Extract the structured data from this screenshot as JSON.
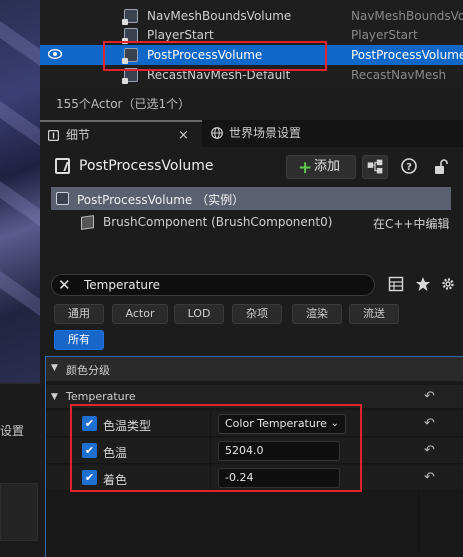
{
  "outliner": {
    "rows": [
      {
        "name": "NavMeshBoundsVolume",
        "type": "NavMeshBoundsVolume"
      },
      {
        "name": "PlayerStart",
        "type": "PlayerStart"
      },
      {
        "name": "PostProcessVolume",
        "type": "PostProcessVolume"
      },
      {
        "name": "RecastNavMesh-Default",
        "type": "RecastNavMesh"
      }
    ],
    "status": "155个Actor（已选1个）"
  },
  "left_panel": {
    "label": "设置"
  },
  "tabs": [
    {
      "label": "细节",
      "close": "×"
    },
    {
      "label": "世界场景设置"
    }
  ],
  "details": {
    "actor_name": "PostProcessVolume",
    "add_button": "添加",
    "add_icon": "+",
    "components": [
      {
        "label": "PostProcessVolume （实例）"
      },
      {
        "label": "BrushComponent (BrushComponent0)",
        "action": "在C++中编辑"
      }
    ]
  },
  "search": {
    "clear": "✕",
    "value": "Temperature",
    "icons": [
      "table-icon",
      "star-icon",
      "gear-icon"
    ]
  },
  "filters": [
    "通用",
    "Actor",
    "LOD",
    "杂项",
    "渲染",
    "流送",
    "所有"
  ],
  "active_filter": "所有",
  "properties": {
    "category": "颜色分级",
    "subcategory": "Temperature",
    "rows": [
      {
        "label": "色温类型",
        "value": "Color Temperature",
        "kind": "select",
        "checked": "✔"
      },
      {
        "label": "色温",
        "value": "5204.0",
        "kind": "number",
        "checked": "✔"
      },
      {
        "label": "着色",
        "value": "-0.24",
        "kind": "number",
        "checked": "✔"
      }
    ],
    "reset_icon": "↶",
    "chevron": "⌄",
    "expanded_arrow": "▼"
  },
  "colors": {
    "selection": "#0f68c8",
    "highlight_box": "#e0242b",
    "accent": "#1f6fd1",
    "add_plus": "#5ec84e"
  }
}
